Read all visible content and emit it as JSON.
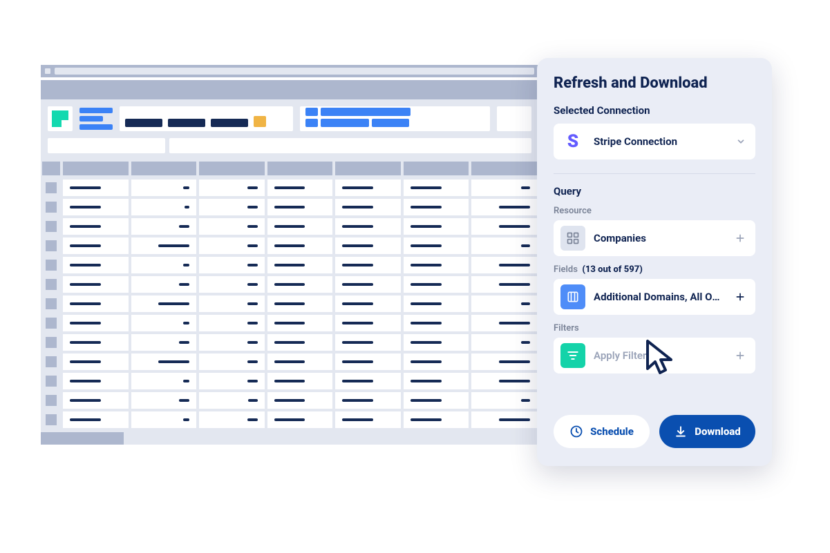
{
  "panel": {
    "title": "Refresh and Download",
    "connection_label": "Selected Connection",
    "connection_value": "Stripe Connection",
    "query_label": "Query",
    "resource_label": "Resource",
    "resource_value": "Companies",
    "fields_label": "Fields",
    "fields_count": "(13 out of 597)",
    "fields_value": "Additional Domains, All Own...",
    "filters_label": "Filters",
    "filters_placeholder": "Apply Filters",
    "schedule_label": "Schedule",
    "download_label": "Download"
  },
  "sheet": {
    "rows": [
      [
        60,
        12,
        20,
        60,
        60,
        60,
        18
      ],
      [
        60,
        10,
        20,
        60,
        60,
        60,
        60
      ],
      [
        60,
        20,
        20,
        60,
        60,
        60,
        60
      ],
      [
        60,
        60,
        20,
        60,
        60,
        60,
        18
      ],
      [
        60,
        12,
        20,
        60,
        60,
        60,
        60
      ],
      [
        60,
        20,
        20,
        60,
        60,
        60,
        60
      ],
      [
        60,
        60,
        20,
        60,
        60,
        60,
        18
      ],
      [
        60,
        12,
        20,
        60,
        60,
        60,
        60
      ],
      [
        60,
        20,
        20,
        60,
        60,
        60,
        18
      ],
      [
        60,
        60,
        20,
        60,
        60,
        60,
        60
      ],
      [
        60,
        12,
        20,
        60,
        60,
        60,
        60
      ],
      [
        60,
        20,
        18,
        60,
        60,
        60,
        18
      ],
      [
        60,
        12,
        20,
        60,
        60,
        60,
        60
      ]
    ]
  }
}
